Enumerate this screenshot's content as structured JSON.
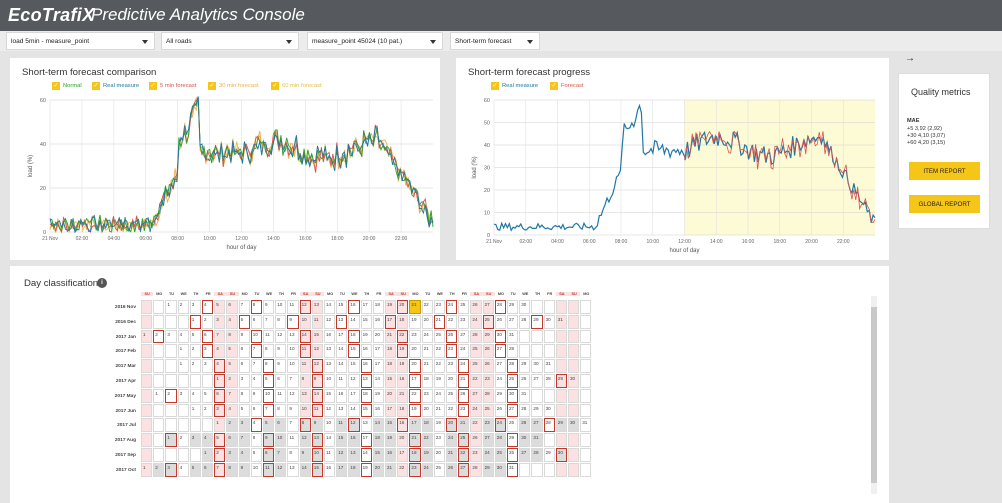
{
  "header": {
    "logo": "EcoTrafiX",
    "title": "Predictive Analytics Console",
    "color": "#56595d"
  },
  "filters": [
    {
      "value": "load 5min - measure_point"
    },
    {
      "value": "All roads"
    },
    {
      "value": "measure_point 45024 (10 pat.)"
    },
    {
      "value": "Short-term forecast"
    }
  ],
  "colors": {
    "accent": "#f5c518",
    "real": "#1f77a4",
    "forecast": "#d9534f",
    "band": "#fdfbd6"
  },
  "comparison": {
    "title": "Short-term forecast comparison",
    "legend": [
      "Normal",
      "Real measure",
      "5 min forecast",
      "30 min forecast",
      "60 min forecast"
    ],
    "legend_colors": [
      "#2aa02a",
      "#1f77a4",
      "#d9534f",
      "#f0ad4e",
      "#e4c04a"
    ],
    "ylabel": "load (%)",
    "xlabel": "hour of day",
    "yticks": [
      "0",
      "20",
      "40",
      "60"
    ],
    "xticks": [
      "21 Nov",
      "02:00",
      "04:00",
      "06:00",
      "08:00",
      "10:00",
      "12:00",
      "14:00",
      "16:00",
      "18:00",
      "20:00",
      "22:00"
    ]
  },
  "progress": {
    "title": "Short-term forecast progress",
    "legend": [
      "Real measure",
      "Forecast"
    ],
    "legend_colors": [
      "#1f77a4",
      "#d9534f"
    ],
    "ylabel": "load (%)",
    "xlabel": "hour of day",
    "yticks": [
      "0",
      "10",
      "20",
      "30",
      "40",
      "50",
      "60"
    ],
    "xticks": [
      "21 Nov",
      "02:00",
      "04:00",
      "06:00",
      "08:00",
      "10:00",
      "12:00",
      "14:00",
      "16:00",
      "18:00",
      "20:00",
      "22:00"
    ]
  },
  "quality": {
    "arrow": "→",
    "title": "Quality metrics",
    "mae_label": "MAE",
    "lines": [
      "+5   3,92 (2,92)",
      "+30  4,10 (3,07)",
      "+60  4,20 (3,15)"
    ],
    "item_report": "ITEM REPORT",
    "global_report": "GLOBAL REPORT"
  },
  "calendar": {
    "title": "Day classification",
    "info": "i",
    "weekdays": [
      "SU",
      "MO",
      "TU",
      "WE",
      "TH",
      "FR",
      "SA",
      "SU",
      "MO",
      "TU",
      "WE",
      "TH",
      "FR",
      "SA",
      "SU",
      "MO",
      "TU",
      "WE",
      "TH",
      "FR",
      "SA",
      "SU",
      "MO",
      "TU",
      "WE",
      "TH",
      "FR",
      "SA",
      "SU",
      "MO",
      "TU",
      "WE",
      "TH",
      "FR",
      "SA",
      "SU",
      "MO"
    ],
    "months": [
      {
        "label": "2016 Nov",
        "offset": 2,
        "days": 30
      },
      {
        "label": "2016 Dec",
        "offset": 4,
        "days": 31
      },
      {
        "label": "2017 Jan",
        "offset": 0,
        "days": 31
      },
      {
        "label": "2017 Feb",
        "offset": 3,
        "days": 28
      },
      {
        "label": "2017 Mar",
        "offset": 3,
        "days": 31
      },
      {
        "label": "2017 Apr",
        "offset": 6,
        "days": 30
      },
      {
        "label": "2017 May",
        "offset": 1,
        "days": 31
      },
      {
        "label": "2017 Jun",
        "offset": 4,
        "days": 30
      },
      {
        "label": "2017 Jul",
        "offset": 6,
        "days": 31
      },
      {
        "label": "2017 Aug",
        "offset": 2,
        "days": 31
      },
      {
        "label": "2017 Sep",
        "offset": 5,
        "days": 30
      },
      {
        "label": "2017 Oct",
        "offset": 0,
        "days": 31
      }
    ]
  }
}
